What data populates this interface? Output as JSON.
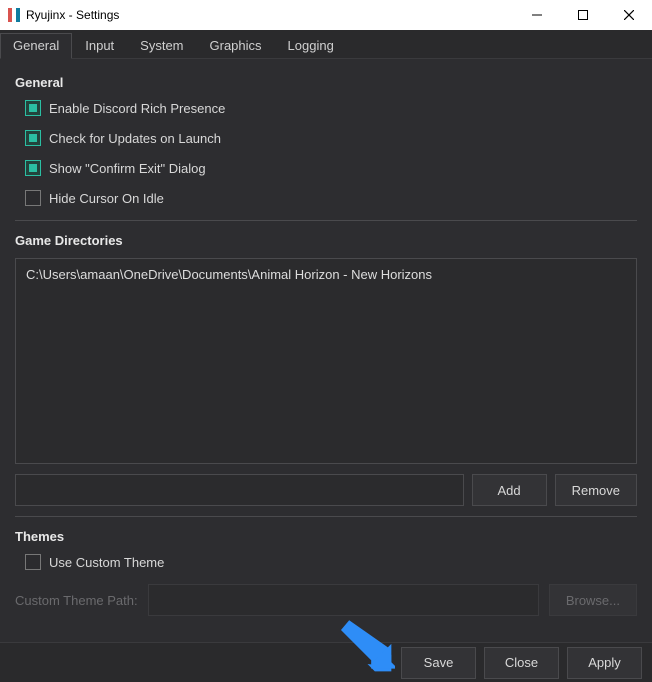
{
  "window": {
    "title": "Ryujinx - Settings"
  },
  "tabs": {
    "general": "General",
    "input": "Input",
    "system": "System",
    "graphics": "Graphics",
    "logging": "Logging"
  },
  "general": {
    "heading": "General",
    "options": {
      "discord": "Enable Discord Rich Presence",
      "updates": "Check for Updates on Launch",
      "confirm_exit": "Show \"Confirm Exit\" Dialog",
      "hide_cursor": "Hide Cursor On Idle"
    }
  },
  "game_dirs": {
    "heading": "Game Directories",
    "entries": [
      "C:\\Users\\amaan\\OneDrive\\Documents\\Animal Horizon - New Horizons"
    ],
    "add": "Add",
    "remove": "Remove"
  },
  "themes": {
    "heading": "Themes",
    "use_custom": "Use Custom Theme",
    "path_label": "Custom Theme Path:",
    "browse": "Browse..."
  },
  "footer": {
    "save": "Save",
    "close": "Close",
    "apply": "Apply"
  },
  "colors": {
    "accent": "#2bbfa3",
    "arrow": "#2e8df7"
  }
}
